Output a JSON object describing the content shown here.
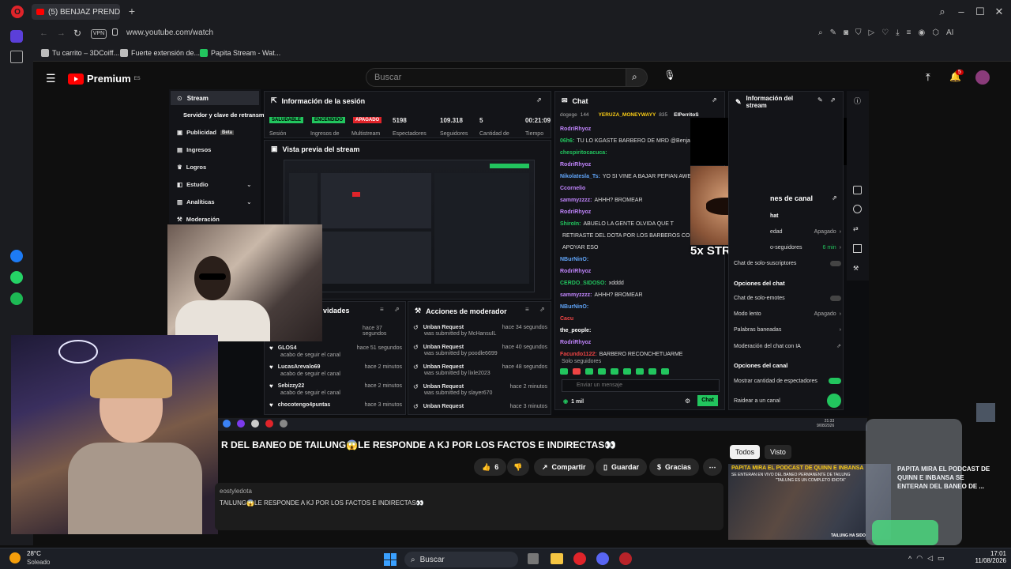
{
  "browser": {
    "tab_title": "(5) BENJAZ PRENDE S",
    "url": "www.youtube.com/watch",
    "vpn_label": "VPN",
    "bookmarks": [
      "Tu carrito – 3DCoiff...",
      "Fuerte extensión de...",
      "Papita Stream - Wat..."
    ],
    "extension_label": "AI"
  },
  "youtube": {
    "logo_text": "Premium",
    "logo_region": "ES",
    "search_placeholder": "Buscar",
    "notification_count": "5"
  },
  "stream_dashboard": {
    "menu": [
      {
        "label": "Stream",
        "icon": "stream-icon"
      },
      {
        "label": "Servidor y clave de retransm",
        "icon": ""
      },
      {
        "label": "Publicidad",
        "badge": "Beta",
        "icon": "ad-icon"
      },
      {
        "label": "Ingresos",
        "icon": "money-icon"
      },
      {
        "label": "Logros",
        "icon": "trophy-icon"
      },
      {
        "label": "Estudio",
        "icon": "studio-icon"
      },
      {
        "label": "Analíticas",
        "icon": "chart-icon"
      },
      {
        "label": "Moderación",
        "icon": "shield-icon"
      }
    ],
    "session_title": "Información de la sesión",
    "session_badges": [
      "SALUDABLE",
      "ENCENDIDO",
      "APAGADO"
    ],
    "session_labels": [
      "Sesión",
      "Ingresos de",
      "Multistream"
    ],
    "stats": [
      {
        "value": "5198",
        "label": "Espectadores"
      },
      {
        "value": "109.318",
        "label": "Seguidores"
      },
      {
        "value": "5",
        "label": "Cantidad de"
      },
      {
        "value": "00:21:09",
        "label": "Tiempo"
      }
    ],
    "preview_title": "Vista previa del stream",
    "activity_title": "vidades",
    "activity": [
      {
        "name": "GLOS4",
        "sub": "acabo de seguir el canal",
        "time": "hace 51 segundos"
      },
      {
        "name": "LucasArevalo69",
        "sub": "acabo de seguir el canal",
        "time": "hace 2 minutos"
      },
      {
        "name": "Sebizzy22",
        "sub": "acabo de seguir el canal",
        "time": "hace 2 minutos"
      },
      {
        "name": "chocotengo4puntas",
        "sub": "",
        "time": "hace 3 minutos"
      }
    ],
    "activity_top_time": "hace 37 segundos",
    "mod_title": "Acciones de moderador",
    "mod_actions": [
      {
        "title": "Unban Request",
        "by": "was submitted by McHansuIL",
        "time": "hace 34 segundos"
      },
      {
        "title": "Unban Request",
        "by": "was submitted by poodle6699",
        "time": "hace 40 segundos"
      },
      {
        "title": "Unban Request",
        "by": "was submitted by lixle2023",
        "time": "hace 48 segundos"
      },
      {
        "title": "Unban Request",
        "by": "was submitted by slayer670",
        "time": "hace 2 minutos"
      },
      {
        "title": "Unban Request",
        "by": "",
        "time": "hace 3 minutos"
      }
    ],
    "chat_title": "Chat",
    "chat_top": {
      "user": "dogege",
      "count": "144",
      "pinned": "YERUZA_MONEYWAYY",
      "pinned_count": "835",
      "other": "ElPerritoS"
    },
    "chat": [
      {
        "user": "RodriRhyoz",
        "msg": "",
        "color": "#c084fc"
      },
      {
        "user": "06h6:",
        "msg": "TU LO KGASTE BARBERO DE MRD @Benjaz",
        "color": "#22c55e"
      },
      {
        "user": "chespiritocacuca:",
        "msg": "",
        "color": "#22c55e"
      },
      {
        "user": "RodriRhyoz",
        "msg": "",
        "color": "#c084fc"
      },
      {
        "user": "Nikolatesla_Ts:",
        "msg": "YO SI VINE A BAJAR PEPIAN AWELO",
        "color": "#60a5fa"
      },
      {
        "user": "Ccornelio",
        "msg": "",
        "color": "#c084fc"
      },
      {
        "user": "sammyzzzz:",
        "msg": "AHHH? BROMEAR",
        "color": "#c084fc"
      },
      {
        "user": "RodriRhyoz",
        "msg": "",
        "color": "#c084fc"
      },
      {
        "user": "ShiroIn:",
        "msg": "ABUELO LA GENTE OLVIDA QUE T",
        "color": "#22c55e"
      },
      {
        "user": "",
        "msg": "RETIRASTE DEL DOTA POR LOS BARBEROS COMO VA",
        "color": "#ddd"
      },
      {
        "user": "",
        "msg": "APOYAR ESO",
        "color": "#ddd"
      },
      {
        "user": "NBurNinO:",
        "msg": "",
        "color": "#60a5fa"
      },
      {
        "user": "RodriRhyoz",
        "msg": "",
        "color": "#c084fc"
      },
      {
        "user": "CERDO_SIDOSO:",
        "msg": "xdddd",
        "color": "#22c55e"
      },
      {
        "user": "sammyzzzz:",
        "msg": "AHHH? BROMEAR",
        "color": "#c084fc"
      },
      {
        "user": "NBurNinO:",
        "msg": "",
        "color": "#60a5fa"
      },
      {
        "user": "Cacu",
        "msg": "",
        "color": "#ef4444"
      },
      {
        "user": "the_people:",
        "msg": "",
        "color": "#fff"
      },
      {
        "user": "RodriRhyoz",
        "msg": "",
        "color": "#c084fc"
      },
      {
        "user": "Facundo1122:",
        "msg": "BARBERO RECONCHETUARME",
        "color": "#ef4444"
      }
    ],
    "chat_mode": "Solo seguidores",
    "chat_input_placeholder": "Enviar un mensaje",
    "chat_viewers": "1 mil",
    "chat_send": "Chat",
    "streak_text": "5x STREAK",
    "right_title": "Información del stream",
    "right_section": "nes de canal",
    "settings": [
      {
        "label": "hat",
        "value": ""
      },
      {
        "label": "edad",
        "value": "Apagado"
      },
      {
        "label": "o-seguidores",
        "value": "6 min"
      },
      {
        "label": "Chat de solo-suscriptores",
        "value": ""
      }
    ],
    "chat_options_title": "Opciones del chat",
    "chat_options": [
      {
        "label": "Chat de solo-emotes",
        "value": ""
      },
      {
        "label": "Modo lento",
        "value": "Apagado"
      },
      {
        "label": "Palabras baneadas",
        "value": ""
      },
      {
        "label": "Moderación del chat con IA",
        "value": ""
      }
    ],
    "channel_options_title": "Opciones del canal",
    "channel_options": [
      {
        "label": "Mostrar cantidad de espectadores",
        "value": "on"
      },
      {
        "label": "Raidear a un canal",
        "value": ""
      }
    ],
    "inner_clock": "21:33",
    "inner_date": "9/08/2026"
  },
  "video": {
    "title": "R DEL BANEO DE TAILUNG😱LE RESPONDE A KJ POR LOS FACTOS E INDIRECTAS👀",
    "likes": "6",
    "share": "Compartir",
    "save": "Guardar",
    "thanks": "Gracias",
    "channel": "eostyledota",
    "desc_line": "TAILUNG😱LE RESPONDE A KJ POR LOS FACTOS E INDIRECTAS👀"
  },
  "recommendations": {
    "chips": [
      "Todos",
      "Visto"
    ],
    "thumb_banner": "PAPITA MIRA EL PODCAST DE QUINN E INBANSA",
    "thumb_sub": "SE ENTERAN EN VIVO DEL BANEO PERMANENTE DE TAILUNG",
    "thumb_quote": "\"TAILUNG ES UN COMPLETO IDIOTA\"",
    "thumb_footer": "TAILUNG HA SIDO",
    "side_title": "PAPITA MIRA EL PODCAST DE QUINN E INBANSA SE ENTERAN DEL BANEO DE ..."
  },
  "taskbar": {
    "weather_temp": "28°C",
    "weather_desc": "Soleado",
    "search_label": "Buscar",
    "time": "17:01",
    "date": "11/08/2026"
  }
}
